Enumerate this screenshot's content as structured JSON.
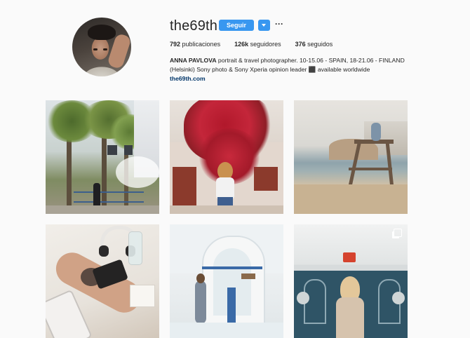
{
  "profile": {
    "username": "the69th",
    "follow_label": "Seguir",
    "more_label": "···",
    "stats": {
      "posts_count": "792",
      "posts_label": " publicaciones",
      "followers_count": "126k",
      "followers_label": " seguidores",
      "following_count": "376",
      "following_label": " seguidos"
    },
    "bio": {
      "name": "ANNA PAVLOVA",
      "text": " portrait & travel photographer. 10-15.06 - SPAIN, 18-21.06 - FINLAND (Helsinki) Sony photo & Sony Xperia opinion leader ⬛ available worldwide ",
      "link": "the69th.com"
    }
  },
  "grid": {
    "posts": [
      {
        "id": "post-1",
        "subject": "palm-trees-street"
      },
      {
        "id": "post-2",
        "subject": "woman-bougainvillea-wall"
      },
      {
        "id": "post-3",
        "subject": "lifeguard-chair-beach"
      },
      {
        "id": "post-4",
        "subject": "headphones-phone-tattoo"
      },
      {
        "id": "post-5",
        "subject": "white-arch-woman"
      },
      {
        "id": "post-6",
        "subject": "metro-station-woman",
        "multi": true
      }
    ]
  },
  "colors": {
    "accent": "#3897f0",
    "link": "#003569",
    "background": "#fafafa",
    "text": "#262626"
  },
  "icons": {
    "dropdown": "chevron-down-icon",
    "more": "ellipsis-icon",
    "multi": "carousel-icon"
  }
}
